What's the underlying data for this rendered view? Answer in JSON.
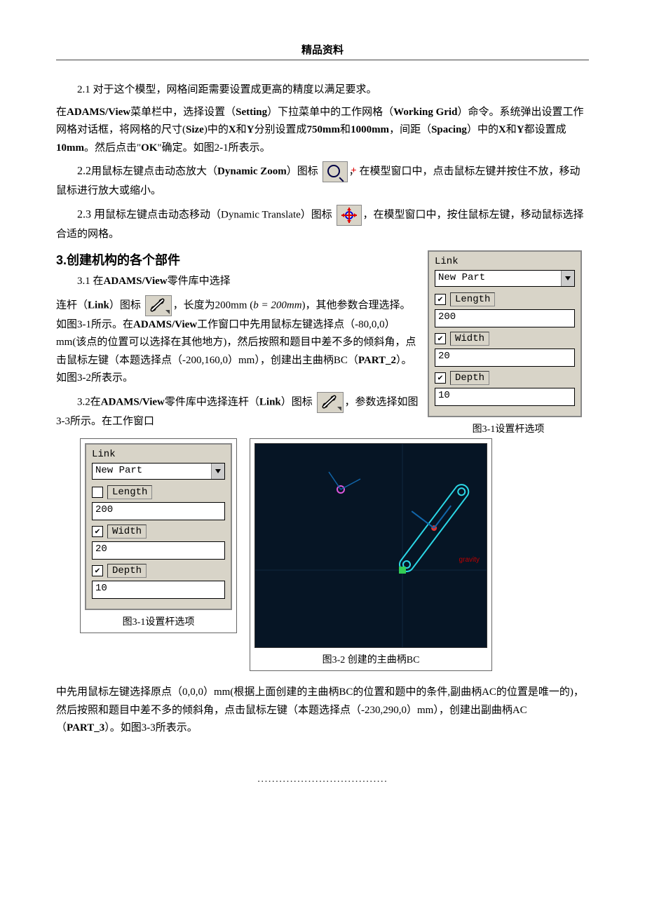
{
  "header": {
    "title": "精品资料"
  },
  "p1": "2.1 对于这个模型，网格间距需要设置成更高的精度以满足要求。",
  "p1b": "在",
  "p1c": "菜单栏中，选择设置（",
  "p1d": "）下拉菜单中的工作网格（",
  "p1e": "）命令。系统弹出设置工作网格对话框，将网格的尺寸(",
  "p1f": ")中的",
  "p1g": "和",
  "p1h": "分别设置成",
  "p1i": "和",
  "p1j": "，间距（",
  "p1k": "）中的",
  "p1l": "都设置成",
  "p1m": "。然后点击\"",
  "p1n": "\"确定。如图2-1所表示。",
  "labels": {
    "adams": "ADAMS/View",
    "setting": "Setting",
    "workingGrid": "Working Grid",
    "size": "Size",
    "x": "X",
    "y": "Y",
    "size750": "750mm",
    "size1000": "1000mm",
    "spacing": "Spacing",
    "spacing10": "10mm",
    "ok": "OK"
  },
  "p2a": "2.2",
  "p2b": "用鼠标左键点击动态放大（",
  "p2c": "Dynamic Zoom",
  "p2d": "）图标",
  "p2e": "，在模型窗口中，点击鼠标左键并按住不放，移动鼠标进行放大或缩小。",
  "p3a": "2.3 用",
  "p3b": "鼠标左键点击动态移动（",
  "p3c": "Dynamic Translate",
  "p3d": "）图标",
  "p3e": "，在模型窗口中，按住鼠标左键，移动鼠标选择合适的网格。",
  "sectionH": "3.创建机构的各个部件",
  "p31a": "3.1 在",
  "p31b": "零件库中选择",
  "p31c": "连杆（",
  "p31d": "Link",
  "p31e": "）图标",
  "p31f": "，长度为200mm (",
  "formula": "b = 200mm",
  "p31g": ")，其他参数合理选择。如图3-1所示。在",
  "p31h": "工作窗口中先用鼠标左键选择点（-80,0,0）mm(该点的位置可以选择在其他地方)，然后按照和题目中差不多的倾斜角，点击鼠标左键（本题选择点（-200,160,0）mm），创建出主曲柄BC（",
  "p31i": "PART_2",
  "p31j": "）。如图3-2所表示。",
  "p32a": "3.2在",
  "p32b": "零件库中选择连杆（",
  "p32c": "Link",
  "p32d": "）图标",
  "p32e": "，参数选择如图3-3所示。在工作窗口",
  "panel1": {
    "title": "Link",
    "combo": "New Part",
    "lengthChk": true,
    "lengthLabel": "Length",
    "lengthVal": "200",
    "widthChk": true,
    "widthLabel": "Width",
    "widthVal": "20",
    "depthChk": true,
    "depthLabel": "Depth",
    "depthVal": "10",
    "caption": "图3-1设置杆选项"
  },
  "panel2": {
    "title": "Link",
    "combo": "New Part",
    "lengthChk": false,
    "lengthLabel": "Length",
    "lengthVal": "200",
    "widthChk": true,
    "widthLabel": "Width",
    "widthVal": "20",
    "depthChk": true,
    "depthLabel": "Depth",
    "depthVal": "10",
    "caption": "图3-1设置杆选项"
  },
  "fig32caption": "图3-2 创建的主曲柄BC",
  "gravityLabel": "gravity",
  "pEnd": "中先用鼠标左键选择原点（0,0,0）mm(根据上面创建的主曲柄BC的位置和题中的条件,副曲柄AC的位置是唯一的)，然后按照和题目中差不多的倾斜角，点击鼠标左键（本题选择点（-230,290,0）mm），创建出副曲柄AC（",
  "pEnd2": "PART_3",
  "pEnd3": "）。如图3-3所表示。",
  "footer": "...................................."
}
